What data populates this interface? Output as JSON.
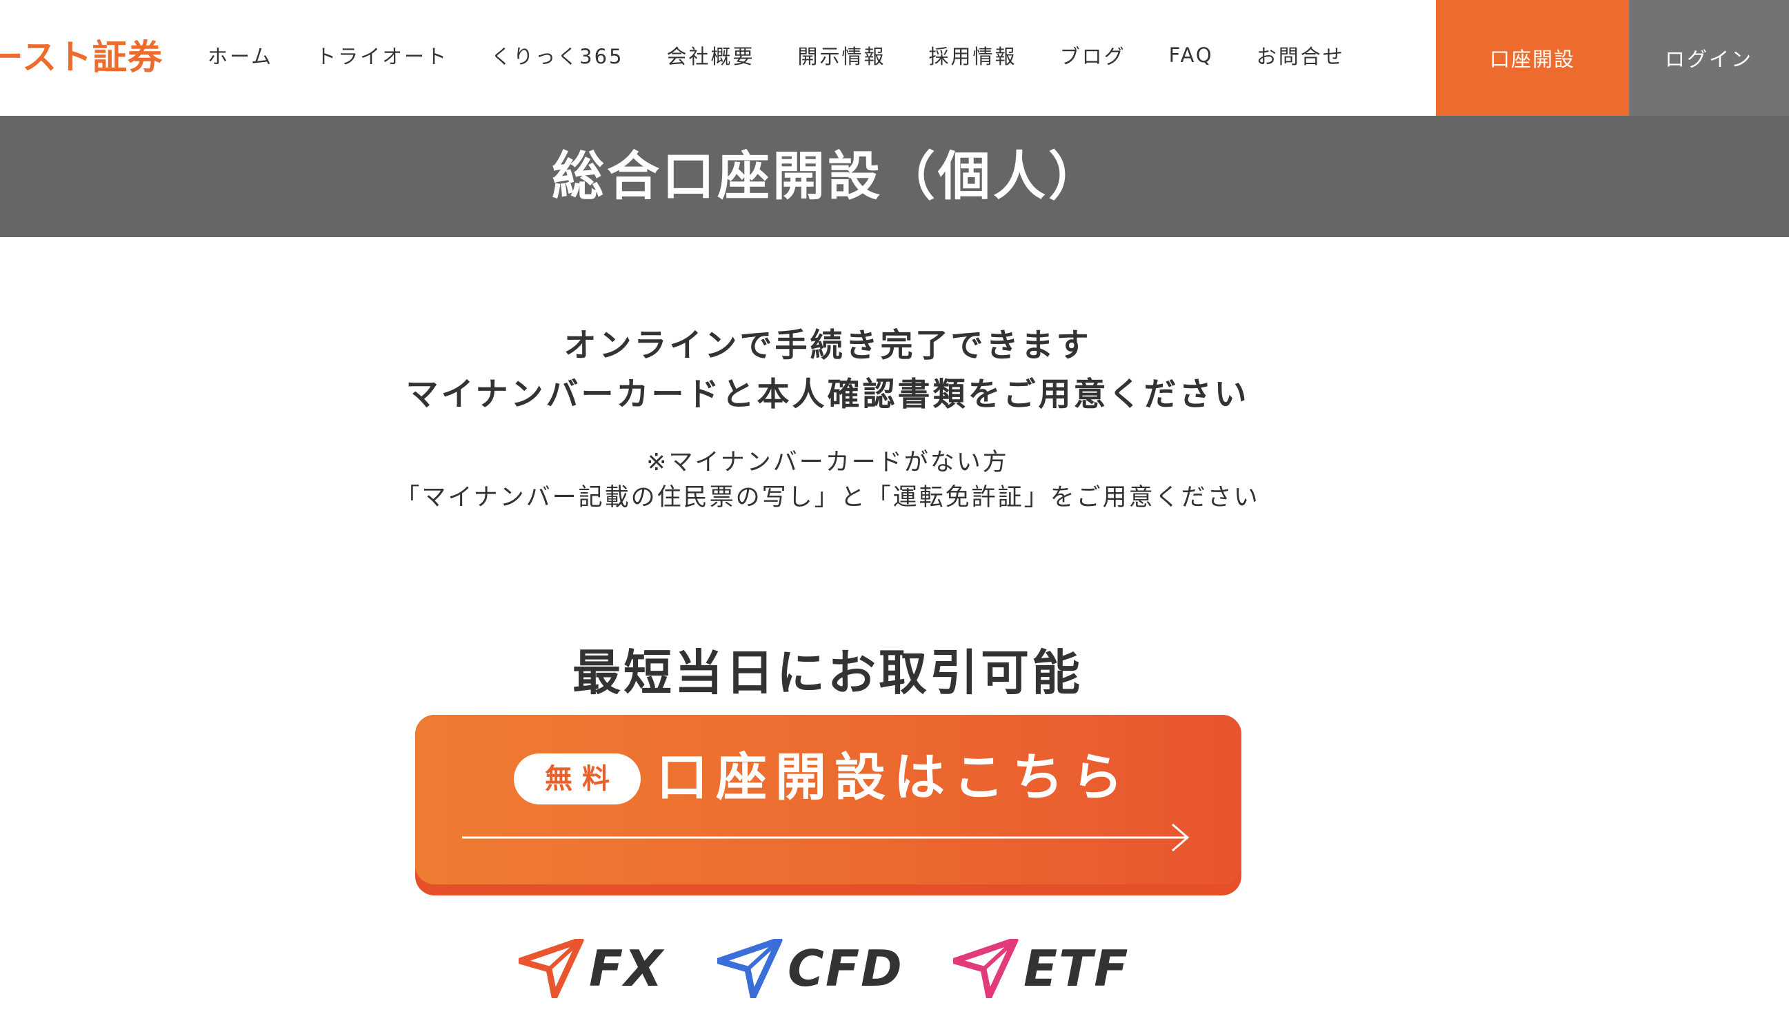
{
  "header": {
    "logo_text": "ファースト証券",
    "nav": [
      {
        "label": "ホーム"
      },
      {
        "label": "トライオート"
      },
      {
        "label": "くりっく365"
      },
      {
        "label": "会社概要"
      },
      {
        "label": "開示情報"
      },
      {
        "label": "採用情報"
      },
      {
        "label": "ブログ"
      },
      {
        "label": "FAQ"
      },
      {
        "label": "お問合せ"
      }
    ],
    "account_open_label": "口座開設",
    "login_label": "ログイン"
  },
  "page": {
    "title": "総合口座開設（個人）"
  },
  "main": {
    "lead_line1": "オンラインで手続き完了できます",
    "lead_line2": "マイナンバーカードと本人確認書類をご用意ください",
    "note_line1": "※マイナンバーカードがない方",
    "note_line2": "「マイナンバー記載の住民票の写し」と「運転免許証」をご用意ください",
    "sub_heading": "最短当日にお取引可能",
    "cta": {
      "badge": "無料",
      "label": "口座開設はこちら"
    },
    "products": [
      {
        "label": "FX",
        "icon": "fx-arrow-icon",
        "color": "#e8552f"
      },
      {
        "label": "CFD",
        "icon": "cfd-arrow-icon",
        "color": "#3b6fd8"
      },
      {
        "label": "ETF",
        "icon": "etf-arrow-icon",
        "color": "#e23b7c"
      }
    ]
  },
  "colors": {
    "brand_orange": "#ec6b2d",
    "login_gray": "#737373",
    "title_band": "#666666",
    "text": "#333333"
  }
}
